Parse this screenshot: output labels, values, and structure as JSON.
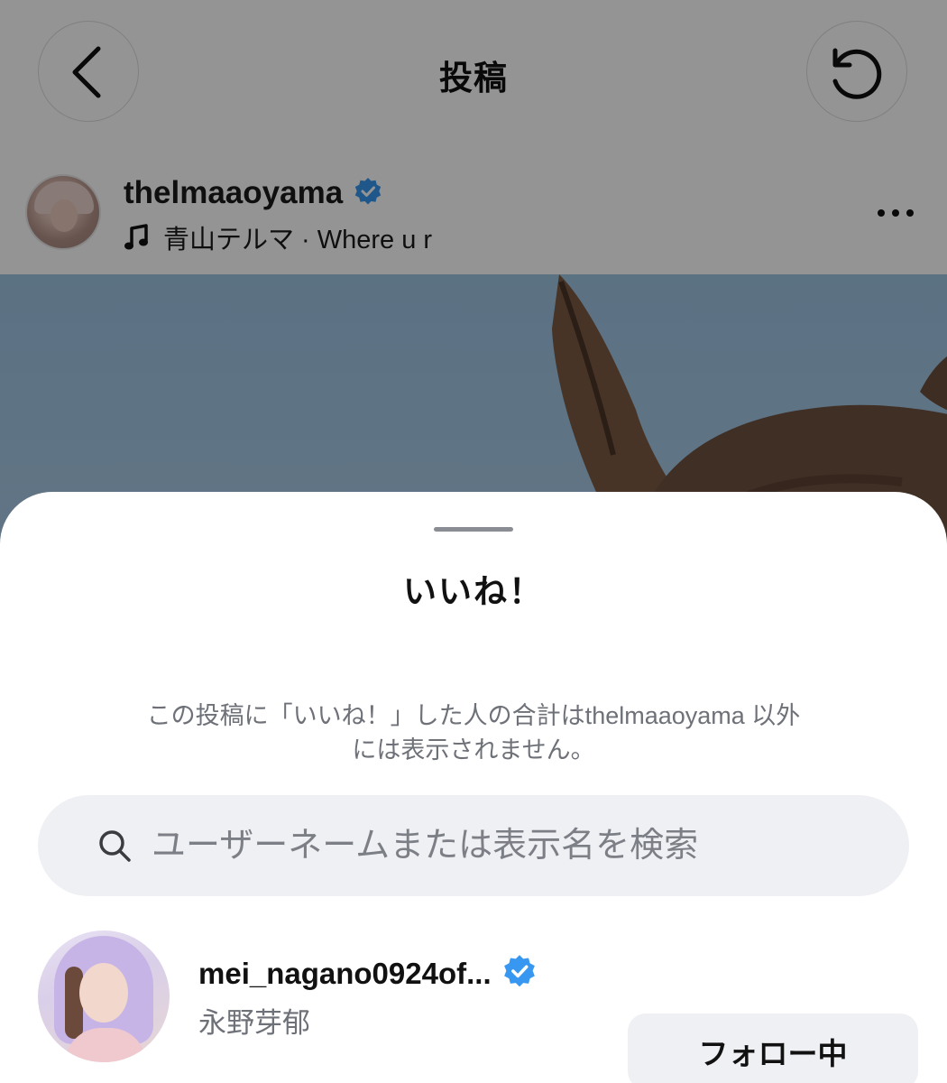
{
  "nav": {
    "title": "投稿"
  },
  "post": {
    "username": "thelmaaoyama",
    "verified": true,
    "music": "青山テルマ · Where u r",
    "icons": {
      "back": "chevron-left-icon",
      "refresh": "refresh-icon",
      "more": "more-horizontal-icon",
      "music": "music-note-icon",
      "verified": "verified-badge-icon"
    }
  },
  "sheet": {
    "title": "いいね！",
    "notice_line1": "この投稿に「いいね！」した人の合計はthelmaaoyama 以外",
    "notice_line2": "には表示されません。",
    "search": {
      "placeholder": "ユーザーネームまたは表示名を検索",
      "value": ""
    },
    "users": [
      {
        "username": "mei_nagano0924of...",
        "display_name": "永野芽郁",
        "verified": true,
        "button_label": "フォロー中"
      }
    ]
  },
  "colors": {
    "verified_blue": "#3897f0",
    "search_bg": "#eff0f3",
    "secondary_text": "#6e7178",
    "overlay": "rgba(0,0,0,0.42)"
  }
}
